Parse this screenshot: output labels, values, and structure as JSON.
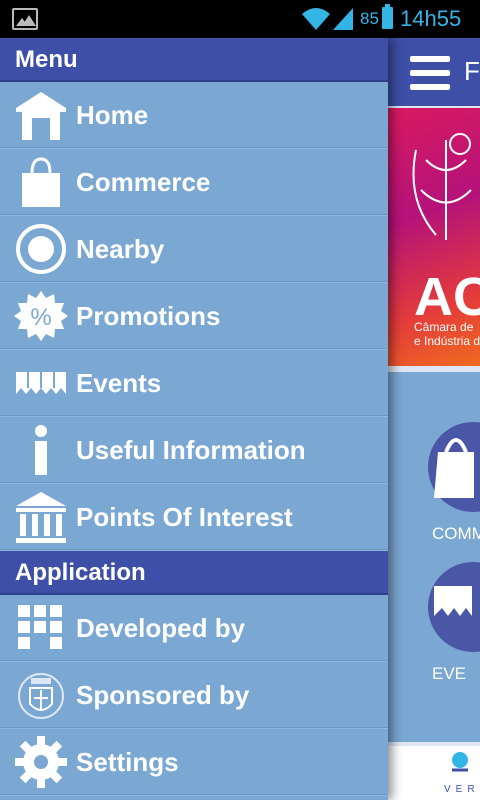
{
  "status_bar": {
    "battery_percent": "85",
    "time": "14h55"
  },
  "background_app": {
    "title_partial": "F",
    "banner_text": "AC",
    "banner_line1": "Câmara de",
    "banner_line2": "e Indústria d",
    "tiles": [
      {
        "label": "COMM",
        "icon": "bag-icon"
      },
      {
        "label": "EVE",
        "icon": "events-icon"
      }
    ],
    "footer_text": "VER"
  },
  "drawer": {
    "sections": [
      {
        "title": "Menu",
        "items": [
          {
            "label": "Home",
            "icon": "home-icon"
          },
          {
            "label": "Commerce",
            "icon": "shopping-bag-icon"
          },
          {
            "label": "Nearby",
            "icon": "radio-circle-icon"
          },
          {
            "label": "Promotions",
            "icon": "percent-badge-icon"
          },
          {
            "label": "Events",
            "icon": "ticket-strip-icon"
          },
          {
            "label": "Useful Information",
            "icon": "info-icon"
          },
          {
            "label": "Points Of Interest",
            "icon": "museum-icon"
          }
        ]
      },
      {
        "title": "Application",
        "items": [
          {
            "label": "Developed by",
            "icon": "grid-blocks-icon"
          },
          {
            "label": "Sponsored by",
            "icon": "coat-of-arms-icon"
          },
          {
            "label": "Settings",
            "icon": "gear-icon"
          }
        ]
      }
    ]
  },
  "colors": {
    "drawer_bg": "#7ba7d3",
    "header_bg": "#3d4fa6",
    "status_accent": "#33b5e5"
  }
}
